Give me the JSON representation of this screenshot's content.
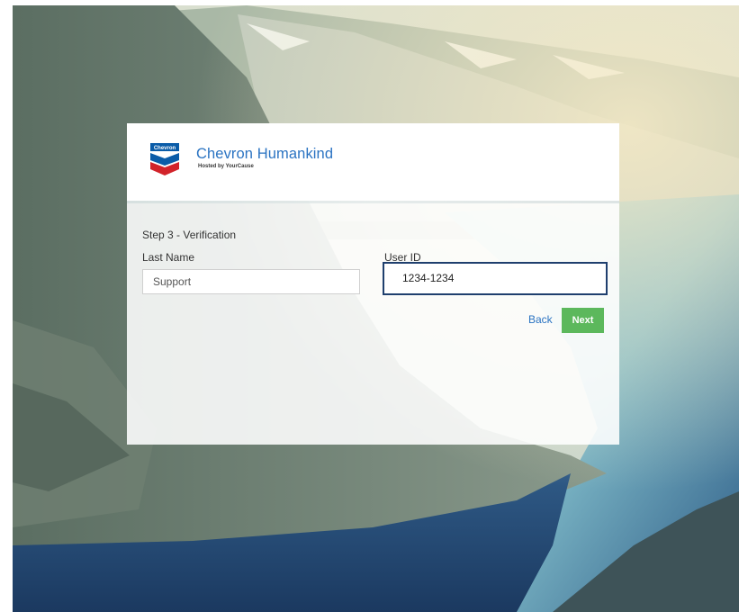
{
  "brand": {
    "logo_name": "chevron-logo",
    "logo_text": "Chevron",
    "title": "Chevron Humankind",
    "subtitle": "Hosted by YourCause"
  },
  "form": {
    "step_title": "Step 3 - Verification",
    "last_name_label": "Last Name",
    "last_name_value": "Support",
    "user_id_label": "User ID",
    "user_id_value": "1234-1234"
  },
  "actions": {
    "back_label": "Back",
    "next_label": "Next"
  },
  "colors": {
    "brand_blue": "#2a73c2",
    "next_green": "#5cb85c",
    "focus_border": "#1f3f6e",
    "chevron_red": "#d2232a",
    "chevron_blue": "#0a5ca8"
  }
}
